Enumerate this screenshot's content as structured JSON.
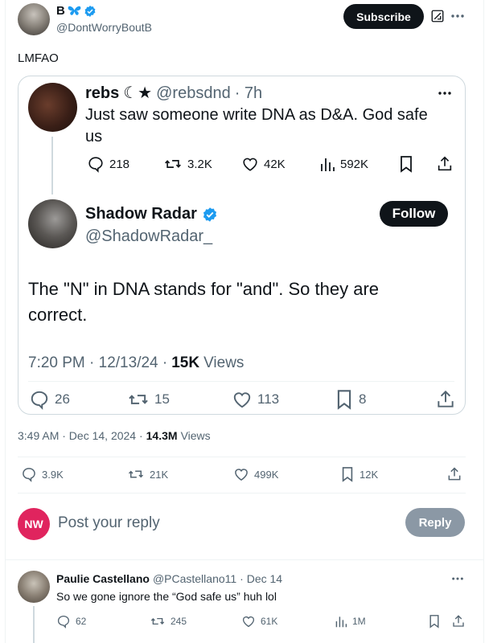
{
  "post": {
    "author_name": "B",
    "author_handle": "@DontWorryBoutB",
    "subscribe_label": "Subscribe",
    "text": "LMFAO",
    "timestamp": "3:49 AM · Dec 14, 2024 ·",
    "views_count": "14.3M",
    "views_label": "Views",
    "stats": {
      "replies": "3.9K",
      "reposts": "21K",
      "likes": "499K",
      "bookmarks": "12K"
    }
  },
  "quote": {
    "parent": {
      "name": "rebs",
      "name_symbols": "☾★",
      "handle": "@rebsdnd",
      "time": "· 7h",
      "text": "Just saw someone write DNA as D&A. God safe us",
      "stats": {
        "replies": "218",
        "reposts": "3.2K",
        "likes": "42K",
        "views": "592K"
      }
    },
    "reply": {
      "name": "Shadow Radar",
      "handle": "@ShadowRadar_",
      "follow_label": "Follow",
      "text": "The \"N\" in DNA stands for \"and\". So they are correct.",
      "time": "7:20 PM · 12/13/24 ·",
      "views_count": "15K",
      "views_label": "Views",
      "stats": {
        "replies": "26",
        "reposts": "15",
        "likes": "113",
        "bookmarks": "8"
      }
    }
  },
  "compose": {
    "avatar_text": "NW",
    "placeholder": "Post your reply",
    "reply_label": "Reply"
  },
  "comment": {
    "name": "Paulie Castellano",
    "handle": "@PCastellano11",
    "time": "· Dec 14",
    "text": "So we gone ignore the “God safe us” huh lol",
    "stats": {
      "replies": "62",
      "reposts": "245",
      "likes": "61K",
      "views": "1M"
    }
  },
  "colors": {
    "accent": "#1d9bf0",
    "text": "#0f1419",
    "muted": "#536471",
    "nw_red": "#e0245e"
  }
}
